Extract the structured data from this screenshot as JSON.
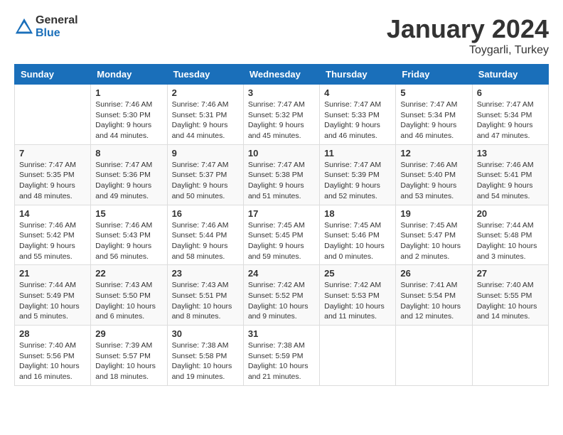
{
  "logo": {
    "general": "General",
    "blue": "Blue"
  },
  "title": "January 2024",
  "location": "Toygarli, Turkey",
  "days_header": [
    "Sunday",
    "Monday",
    "Tuesday",
    "Wednesday",
    "Thursday",
    "Friday",
    "Saturday"
  ],
  "weeks": [
    [
      {
        "day": "",
        "info": ""
      },
      {
        "day": "1",
        "info": "Sunrise: 7:46 AM\nSunset: 5:30 PM\nDaylight: 9 hours\nand 44 minutes."
      },
      {
        "day": "2",
        "info": "Sunrise: 7:46 AM\nSunset: 5:31 PM\nDaylight: 9 hours\nand 44 minutes."
      },
      {
        "day": "3",
        "info": "Sunrise: 7:47 AM\nSunset: 5:32 PM\nDaylight: 9 hours\nand 45 minutes."
      },
      {
        "day": "4",
        "info": "Sunrise: 7:47 AM\nSunset: 5:33 PM\nDaylight: 9 hours\nand 46 minutes."
      },
      {
        "day": "5",
        "info": "Sunrise: 7:47 AM\nSunset: 5:34 PM\nDaylight: 9 hours\nand 46 minutes."
      },
      {
        "day": "6",
        "info": "Sunrise: 7:47 AM\nSunset: 5:34 PM\nDaylight: 9 hours\nand 47 minutes."
      }
    ],
    [
      {
        "day": "7",
        "info": "Sunrise: 7:47 AM\nSunset: 5:35 PM\nDaylight: 9 hours\nand 48 minutes."
      },
      {
        "day": "8",
        "info": "Sunrise: 7:47 AM\nSunset: 5:36 PM\nDaylight: 9 hours\nand 49 minutes."
      },
      {
        "day": "9",
        "info": "Sunrise: 7:47 AM\nSunset: 5:37 PM\nDaylight: 9 hours\nand 50 minutes."
      },
      {
        "day": "10",
        "info": "Sunrise: 7:47 AM\nSunset: 5:38 PM\nDaylight: 9 hours\nand 51 minutes."
      },
      {
        "day": "11",
        "info": "Sunrise: 7:47 AM\nSunset: 5:39 PM\nDaylight: 9 hours\nand 52 minutes."
      },
      {
        "day": "12",
        "info": "Sunrise: 7:46 AM\nSunset: 5:40 PM\nDaylight: 9 hours\nand 53 minutes."
      },
      {
        "day": "13",
        "info": "Sunrise: 7:46 AM\nSunset: 5:41 PM\nDaylight: 9 hours\nand 54 minutes."
      }
    ],
    [
      {
        "day": "14",
        "info": "Sunrise: 7:46 AM\nSunset: 5:42 PM\nDaylight: 9 hours\nand 55 minutes."
      },
      {
        "day": "15",
        "info": "Sunrise: 7:46 AM\nSunset: 5:43 PM\nDaylight: 9 hours\nand 56 minutes."
      },
      {
        "day": "16",
        "info": "Sunrise: 7:46 AM\nSunset: 5:44 PM\nDaylight: 9 hours\nand 58 minutes."
      },
      {
        "day": "17",
        "info": "Sunrise: 7:45 AM\nSunset: 5:45 PM\nDaylight: 9 hours\nand 59 minutes."
      },
      {
        "day": "18",
        "info": "Sunrise: 7:45 AM\nSunset: 5:46 PM\nDaylight: 10 hours\nand 0 minutes."
      },
      {
        "day": "19",
        "info": "Sunrise: 7:45 AM\nSunset: 5:47 PM\nDaylight: 10 hours\nand 2 minutes."
      },
      {
        "day": "20",
        "info": "Sunrise: 7:44 AM\nSunset: 5:48 PM\nDaylight: 10 hours\nand 3 minutes."
      }
    ],
    [
      {
        "day": "21",
        "info": "Sunrise: 7:44 AM\nSunset: 5:49 PM\nDaylight: 10 hours\nand 5 minutes."
      },
      {
        "day": "22",
        "info": "Sunrise: 7:43 AM\nSunset: 5:50 PM\nDaylight: 10 hours\nand 6 minutes."
      },
      {
        "day": "23",
        "info": "Sunrise: 7:43 AM\nSunset: 5:51 PM\nDaylight: 10 hours\nand 8 minutes."
      },
      {
        "day": "24",
        "info": "Sunrise: 7:42 AM\nSunset: 5:52 PM\nDaylight: 10 hours\nand 9 minutes."
      },
      {
        "day": "25",
        "info": "Sunrise: 7:42 AM\nSunset: 5:53 PM\nDaylight: 10 hours\nand 11 minutes."
      },
      {
        "day": "26",
        "info": "Sunrise: 7:41 AM\nSunset: 5:54 PM\nDaylight: 10 hours\nand 12 minutes."
      },
      {
        "day": "27",
        "info": "Sunrise: 7:40 AM\nSunset: 5:55 PM\nDaylight: 10 hours\nand 14 minutes."
      }
    ],
    [
      {
        "day": "28",
        "info": "Sunrise: 7:40 AM\nSunset: 5:56 PM\nDaylight: 10 hours\nand 16 minutes."
      },
      {
        "day": "29",
        "info": "Sunrise: 7:39 AM\nSunset: 5:57 PM\nDaylight: 10 hours\nand 18 minutes."
      },
      {
        "day": "30",
        "info": "Sunrise: 7:38 AM\nSunset: 5:58 PM\nDaylight: 10 hours\nand 19 minutes."
      },
      {
        "day": "31",
        "info": "Sunrise: 7:38 AM\nSunset: 5:59 PM\nDaylight: 10 hours\nand 21 minutes."
      },
      {
        "day": "",
        "info": ""
      },
      {
        "day": "",
        "info": ""
      },
      {
        "day": "",
        "info": ""
      }
    ]
  ]
}
